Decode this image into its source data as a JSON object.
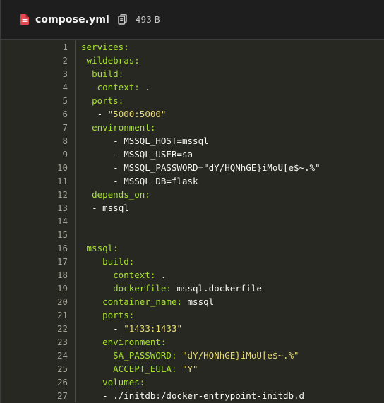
{
  "header": {
    "file_name": "compose.yml",
    "file_size": "493 B",
    "file_icon": "yaml-file-icon",
    "copy_icon": "copy-icon"
  },
  "colors": {
    "key": "#a6e22e",
    "string": "#e6db74",
    "plain": "#f8f8f2",
    "line_number": "#a4a49a",
    "code_bg": "#272822"
  },
  "code": {
    "lines": [
      {
        "n": "1",
        "indent": "",
        "parts": [
          {
            "t": "services:",
            "c": "key"
          }
        ]
      },
      {
        "n": "2",
        "indent": " ",
        "parts": [
          {
            "t": "wildebras:",
            "c": "key"
          }
        ]
      },
      {
        "n": "3",
        "indent": "  ",
        "parts": [
          {
            "t": "build:",
            "c": "key"
          }
        ]
      },
      {
        "n": "4",
        "indent": "   ",
        "parts": [
          {
            "t": "context:",
            "c": "key"
          },
          {
            "t": " .",
            "c": "plain"
          }
        ]
      },
      {
        "n": "5",
        "indent": "  ",
        "parts": [
          {
            "t": "ports:",
            "c": "key"
          }
        ]
      },
      {
        "n": "6",
        "indent": "   ",
        "parts": [
          {
            "t": "- ",
            "c": "plain"
          },
          {
            "t": "\"5000:5000\"",
            "c": "string"
          }
        ]
      },
      {
        "n": "7",
        "indent": "  ",
        "parts": [
          {
            "t": "environment:",
            "c": "key"
          }
        ]
      },
      {
        "n": "8",
        "indent": "      ",
        "parts": [
          {
            "t": "- MSSQL_HOST=mssql",
            "c": "plain"
          }
        ]
      },
      {
        "n": "9",
        "indent": "      ",
        "parts": [
          {
            "t": "- MSSQL_USER=sa",
            "c": "plain"
          }
        ]
      },
      {
        "n": "10",
        "indent": "      ",
        "parts": [
          {
            "t": "- MSSQL_PASSWORD=\"dY/HQNhGE}iMoU[e$~.%\"",
            "c": "plain"
          }
        ]
      },
      {
        "n": "11",
        "indent": "      ",
        "parts": [
          {
            "t": "- MSSQL_DB=flask",
            "c": "plain"
          }
        ]
      },
      {
        "n": "12",
        "indent": "  ",
        "parts": [
          {
            "t": "depends_on:",
            "c": "key"
          }
        ]
      },
      {
        "n": "13",
        "indent": "  ",
        "parts": [
          {
            "t": "- mssql",
            "c": "plain"
          }
        ]
      },
      {
        "n": "14",
        "indent": "",
        "parts": []
      },
      {
        "n": "15",
        "indent": "",
        "parts": []
      },
      {
        "n": "16",
        "indent": " ",
        "parts": [
          {
            "t": "mssql:",
            "c": "key"
          }
        ]
      },
      {
        "n": "17",
        "indent": "    ",
        "parts": [
          {
            "t": "build:",
            "c": "key"
          }
        ]
      },
      {
        "n": "18",
        "indent": "      ",
        "parts": [
          {
            "t": "context:",
            "c": "key"
          },
          {
            "t": " .",
            "c": "plain"
          }
        ]
      },
      {
        "n": "19",
        "indent": "      ",
        "parts": [
          {
            "t": "dockerfile:",
            "c": "key"
          },
          {
            "t": " mssql.dockerfile",
            "c": "plain"
          }
        ]
      },
      {
        "n": "20",
        "indent": "    ",
        "parts": [
          {
            "t": "container_name:",
            "c": "key"
          },
          {
            "t": " mssql",
            "c": "plain"
          }
        ]
      },
      {
        "n": "21",
        "indent": "    ",
        "parts": [
          {
            "t": "ports:",
            "c": "key"
          }
        ]
      },
      {
        "n": "22",
        "indent": "      ",
        "parts": [
          {
            "t": "- ",
            "c": "plain"
          },
          {
            "t": "\"1433:1433\"",
            "c": "string"
          }
        ]
      },
      {
        "n": "23",
        "indent": "    ",
        "parts": [
          {
            "t": "environment:",
            "c": "key"
          }
        ]
      },
      {
        "n": "24",
        "indent": "      ",
        "parts": [
          {
            "t": "SA_PASSWORD:",
            "c": "key"
          },
          {
            "t": " ",
            "c": "plain"
          },
          {
            "t": "\"dY/HQNhGE}iMoU[e$~.%\"",
            "c": "string"
          }
        ]
      },
      {
        "n": "25",
        "indent": "      ",
        "parts": [
          {
            "t": "ACCEPT_EULA:",
            "c": "key"
          },
          {
            "t": " ",
            "c": "plain"
          },
          {
            "t": "\"Y\"",
            "c": "string"
          }
        ]
      },
      {
        "n": "26",
        "indent": "    ",
        "parts": [
          {
            "t": "volumes:",
            "c": "key"
          }
        ]
      },
      {
        "n": "27",
        "indent": "    ",
        "parts": [
          {
            "t": "- ./initdb:/docker-entrypoint-initdb.d",
            "c": "plain"
          }
        ]
      }
    ]
  }
}
